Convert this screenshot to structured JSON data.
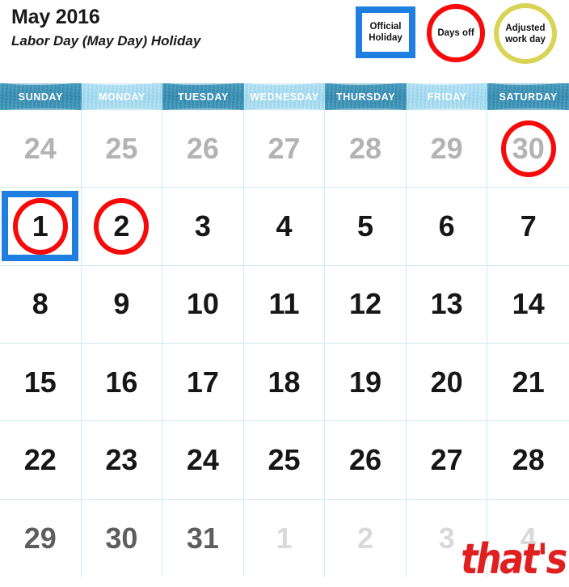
{
  "header": {
    "title": "May 2016",
    "subtitle": "Labor Day (May Day) Holiday"
  },
  "legend": {
    "items": [
      {
        "id": "official-holiday",
        "label": "Official Holiday",
        "shape": "square",
        "color": "#1f7fe0"
      },
      {
        "id": "days-off",
        "label": "Days off",
        "shape": "circle",
        "color": "#f60a0a"
      },
      {
        "id": "adjusted-work-day",
        "label": "Adjusted work day",
        "shape": "circle",
        "color": "#d9d455"
      }
    ]
  },
  "calendar": {
    "weekdays": [
      {
        "label": "SUNDAY",
        "band": "dark"
      },
      {
        "label": "MONDAY",
        "band": "light"
      },
      {
        "label": "TUESDAY",
        "band": "dark"
      },
      {
        "label": "WEDNESDAY",
        "band": "light"
      },
      {
        "label": "THURSDAY",
        "band": "dark"
      },
      {
        "label": "FRIDAY",
        "band": "light"
      },
      {
        "label": "SATURDAY",
        "band": "dark"
      }
    ],
    "weeks": [
      [
        {
          "day": "24",
          "style": "muted",
          "markers": []
        },
        {
          "day": "25",
          "style": "muted",
          "markers": []
        },
        {
          "day": "26",
          "style": "muted",
          "markers": []
        },
        {
          "day": "27",
          "style": "muted",
          "markers": []
        },
        {
          "day": "28",
          "style": "muted",
          "markers": []
        },
        {
          "day": "29",
          "style": "muted",
          "markers": []
        },
        {
          "day": "30",
          "style": "muted",
          "markers": [
            "days-off"
          ]
        }
      ],
      [
        {
          "day": "1",
          "style": "normal",
          "markers": [
            "official-holiday",
            "days-off"
          ]
        },
        {
          "day": "2",
          "style": "normal",
          "markers": [
            "days-off"
          ]
        },
        {
          "day": "3",
          "style": "normal",
          "markers": []
        },
        {
          "day": "4",
          "style": "normal",
          "markers": []
        },
        {
          "day": "5",
          "style": "normal",
          "markers": []
        },
        {
          "day": "6",
          "style": "normal",
          "markers": []
        },
        {
          "day": "7",
          "style": "normal",
          "markers": []
        }
      ],
      [
        {
          "day": "8",
          "style": "normal",
          "markers": []
        },
        {
          "day": "9",
          "style": "normal",
          "markers": []
        },
        {
          "day": "10",
          "style": "normal",
          "markers": []
        },
        {
          "day": "11",
          "style": "normal",
          "markers": []
        },
        {
          "day": "12",
          "style": "normal",
          "markers": []
        },
        {
          "day": "13",
          "style": "normal",
          "markers": []
        },
        {
          "day": "14",
          "style": "normal",
          "markers": []
        }
      ],
      [
        {
          "day": "15",
          "style": "normal",
          "markers": []
        },
        {
          "day": "16",
          "style": "normal",
          "markers": []
        },
        {
          "day": "17",
          "style": "normal",
          "markers": []
        },
        {
          "day": "18",
          "style": "normal",
          "markers": []
        },
        {
          "day": "19",
          "style": "normal",
          "markers": []
        },
        {
          "day": "20",
          "style": "normal",
          "markers": []
        },
        {
          "day": "21",
          "style": "normal",
          "markers": []
        }
      ],
      [
        {
          "day": "22",
          "style": "normal",
          "markers": []
        },
        {
          "day": "23",
          "style": "normal",
          "markers": []
        },
        {
          "day": "24",
          "style": "normal",
          "markers": []
        },
        {
          "day": "25",
          "style": "normal",
          "markers": []
        },
        {
          "day": "26",
          "style": "normal",
          "markers": []
        },
        {
          "day": "27",
          "style": "normal",
          "markers": []
        },
        {
          "day": "28",
          "style": "normal",
          "markers": []
        }
      ],
      [
        {
          "day": "29",
          "style": "muted2",
          "markers": []
        },
        {
          "day": "30",
          "style": "muted2",
          "markers": []
        },
        {
          "day": "31",
          "style": "muted2",
          "markers": []
        },
        {
          "day": "1",
          "style": "faint",
          "markers": []
        },
        {
          "day": "2",
          "style": "faint",
          "markers": []
        },
        {
          "day": "3",
          "style": "faint",
          "markers": []
        },
        {
          "day": "4",
          "style": "faint",
          "markers": []
        }
      ]
    ]
  },
  "logo": {
    "text": "that's",
    "color": "#e02020"
  }
}
